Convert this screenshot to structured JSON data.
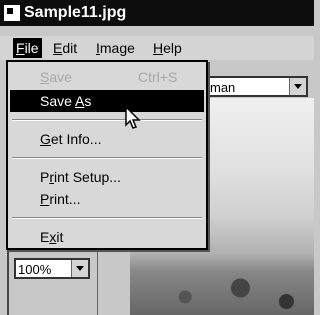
{
  "window": {
    "title": "Sample11.jpg",
    "icon": "app-icon"
  },
  "menubar": {
    "file": {
      "pre": "",
      "acc": "F",
      "post": "ile"
    },
    "edit": {
      "pre": "",
      "acc": "E",
      "post": "dit"
    },
    "image": {
      "pre": "",
      "acc": "I",
      "post": "mage"
    },
    "help": {
      "pre": "",
      "acc": "H",
      "post": "elp"
    }
  },
  "file_menu": {
    "save": {
      "pre": "",
      "acc": "S",
      "post": "ave",
      "shortcut": "Ctrl+S",
      "enabled": false
    },
    "save_as": {
      "pre": "Save ",
      "acc": "A",
      "post": "s",
      "selected": true
    },
    "get_info": {
      "pre": "",
      "acc": "G",
      "post": "et Info..."
    },
    "print_setup": {
      "pre": "P",
      "acc": "r",
      "post": "int Setup..."
    },
    "print": {
      "pre": "",
      "acc": "P",
      "post": "rint..."
    },
    "exit": {
      "pre": "E",
      "acc": "x",
      "post": "it"
    }
  },
  "font_select": {
    "value": "man"
  },
  "zoom_select": {
    "value": "100%"
  }
}
